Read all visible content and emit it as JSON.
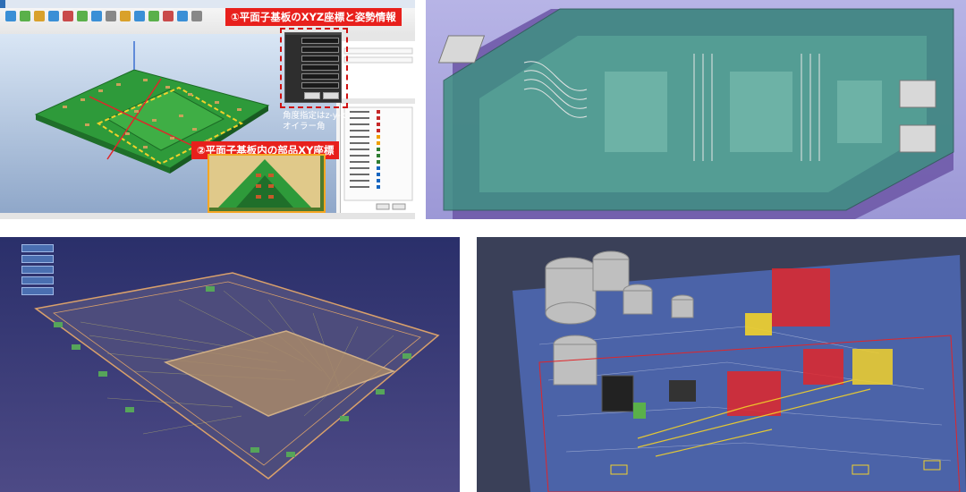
{
  "panel1": {
    "callout_xyz": "①平面子基板のXYZ座標と姿勢情報",
    "callout_xy": "②平面子基板内の部品XY座標",
    "angle_note_line1": "角度指定はz-y-x",
    "angle_note_line2": "オイラー角"
  },
  "colors": {
    "callout_bg": "#e8201c",
    "board_green": "#2e9a3a",
    "package_teal": "#3f8f82",
    "pcb_blue": "#4b63a8",
    "highlight_red": "#e0262a",
    "highlight_yellow": "#f2d12a"
  }
}
